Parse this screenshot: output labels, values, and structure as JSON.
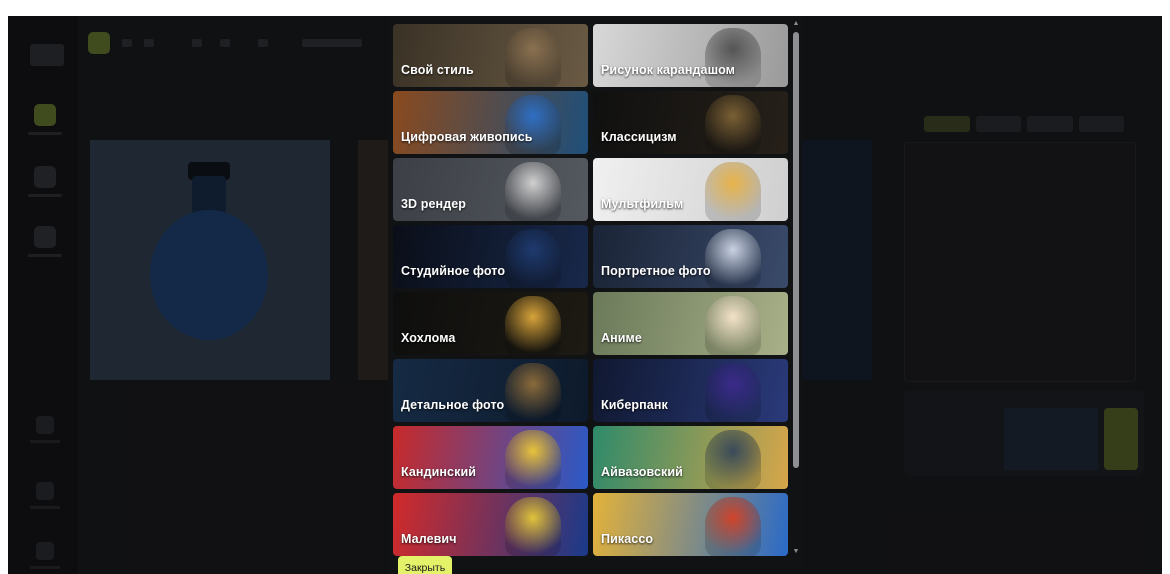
{
  "modal": {
    "title": "",
    "close_label": "Закрыть"
  },
  "styles": [
    {
      "label": "Свой стиль",
      "bg": [
        "#3a3226",
        "#6a5a44"
      ],
      "cat": "#8a7050"
    },
    {
      "label": "Рисунок карандашом",
      "bg": [
        "#d8d8d8",
        "#9a9a9a"
      ],
      "cat": "#555555"
    },
    {
      "label": "Цифровая живопись",
      "bg": [
        "#8a4a1e",
        "#1f4f7a"
      ],
      "cat": "#2f6fc4"
    },
    {
      "label": "Классицизм",
      "bg": [
        "#101010",
        "#262019"
      ],
      "cat": "#7a6034"
    },
    {
      "label": "3D рендер",
      "bg": [
        "#3c4046",
        "#54585f"
      ],
      "cat": "#d0d0d0"
    },
    {
      "label": "Мультфильм",
      "bg": [
        "#f0f0f0",
        "#cfcfcf"
      ],
      "cat": "#e7b34a"
    },
    {
      "label": "Студийное фото",
      "bg": [
        "#0a0e18",
        "#18284a"
      ],
      "cat": "#1e3a6e"
    },
    {
      "label": "Портретное фото",
      "bg": [
        "#1a2436",
        "#3a4a6a"
      ],
      "cat": "#c9d2e2"
    },
    {
      "label": "Хохлома",
      "bg": [
        "#0e0e0e",
        "#1d1a12"
      ],
      "cat": "#d7a33a"
    },
    {
      "label": "Аниме",
      "bg": [
        "#6b7a5a",
        "#a8b088"
      ],
      "cat": "#f2e2c8"
    },
    {
      "label": "Детальное фото",
      "bg": [
        "#162a44",
        "#0d1a2b"
      ],
      "cat": "#8a6a3a"
    },
    {
      "label": "Киберпанк",
      "bg": [
        "#101830",
        "#2a3a7a"
      ],
      "cat": "#3a2a8a"
    },
    {
      "label": "Кандинский",
      "bg": [
        "#c82a2a",
        "#2a5ac8"
      ],
      "cat": "#e8c23a"
    },
    {
      "label": "Айвазовский",
      "bg": [
        "#2e8a6a",
        "#d7a64a"
      ],
      "cat": "#3a4a5a"
    },
    {
      "label": "Малевич",
      "bg": [
        "#d22a2a",
        "#1a3a8a"
      ],
      "cat": "#e0c23a"
    },
    {
      "label": "Пикассо",
      "bg": [
        "#e3b23a",
        "#2a6ac8"
      ],
      "cat": "#d0442a"
    }
  ]
}
